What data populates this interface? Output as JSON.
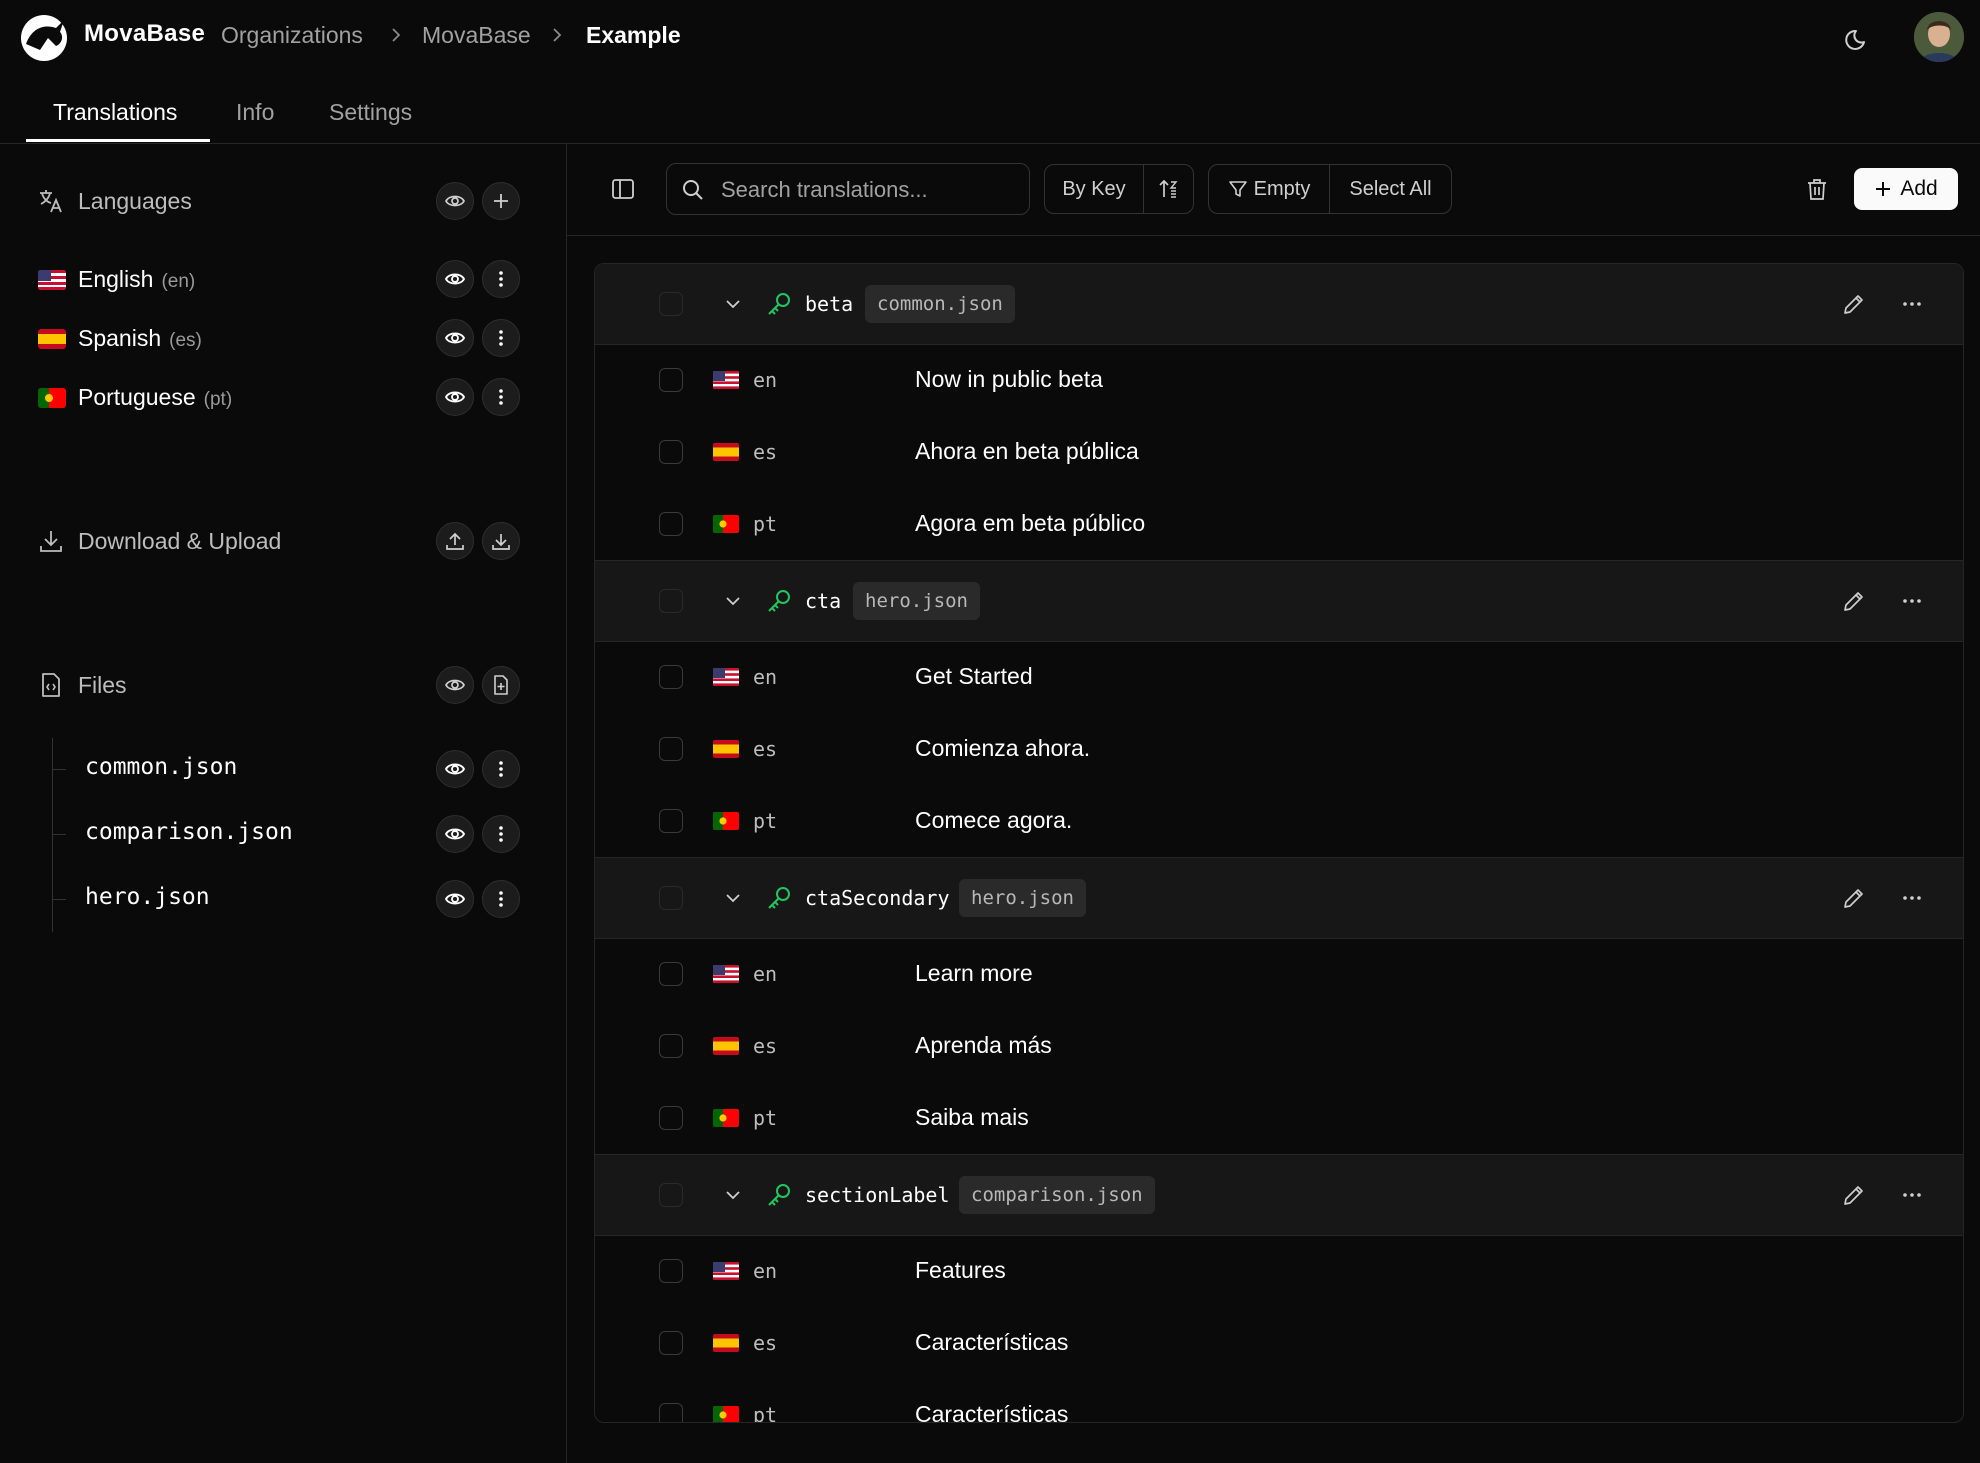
{
  "header": {
    "brand": "MovaBase",
    "breadcrumb": [
      "Organizations",
      "MovaBase",
      "Example"
    ]
  },
  "tabs": [
    "Translations",
    "Info",
    "Settings"
  ],
  "sidebar": {
    "languages_title": "Languages",
    "languages": [
      {
        "name": "English",
        "code": "(en)",
        "flag": "us"
      },
      {
        "name": "Spanish",
        "code": "(es)",
        "flag": "es"
      },
      {
        "name": "Portuguese",
        "code": "(pt)",
        "flag": "pt"
      }
    ],
    "download_title": "Download & Upload",
    "files_title": "Files",
    "files": [
      "common.json",
      "comparison.json",
      "hero.json"
    ]
  },
  "toolbar": {
    "search_placeholder": "Search translations...",
    "sort_label": "By Key",
    "filter_label": "Empty",
    "select_all_label": "Select All",
    "add_label": "Add"
  },
  "groups": [
    {
      "key": "beta",
      "file": "common.json",
      "rows": [
        {
          "code": "en",
          "flag": "us",
          "value": "Now in public beta"
        },
        {
          "code": "es",
          "flag": "es",
          "value": "Ahora en beta pública"
        },
        {
          "code": "pt",
          "flag": "pt",
          "value": "Agora em beta público"
        }
      ]
    },
    {
      "key": "cta",
      "file": "hero.json",
      "rows": [
        {
          "code": "en",
          "flag": "us",
          "value": "Get Started"
        },
        {
          "code": "es",
          "flag": "es",
          "value": "Comienza ahora."
        },
        {
          "code": "pt",
          "flag": "pt",
          "value": "Comece agora."
        }
      ]
    },
    {
      "key": "ctaSecondary",
      "file": "hero.json",
      "rows": [
        {
          "code": "en",
          "flag": "us",
          "value": "Learn more"
        },
        {
          "code": "es",
          "flag": "es",
          "value": "Aprenda más"
        },
        {
          "code": "pt",
          "flag": "pt",
          "value": "Saiba mais"
        }
      ]
    },
    {
      "key": "sectionLabel",
      "file": "comparison.json",
      "rows": [
        {
          "code": "en",
          "flag": "us",
          "value": "Features"
        },
        {
          "code": "es",
          "flag": "es",
          "value": "Características"
        },
        {
          "code": "pt",
          "flag": "pt",
          "value": "Características"
        }
      ]
    }
  ],
  "colors": {
    "accent_key": "#22c55e",
    "background": "#0a0a0a",
    "group_header": "#171717"
  }
}
